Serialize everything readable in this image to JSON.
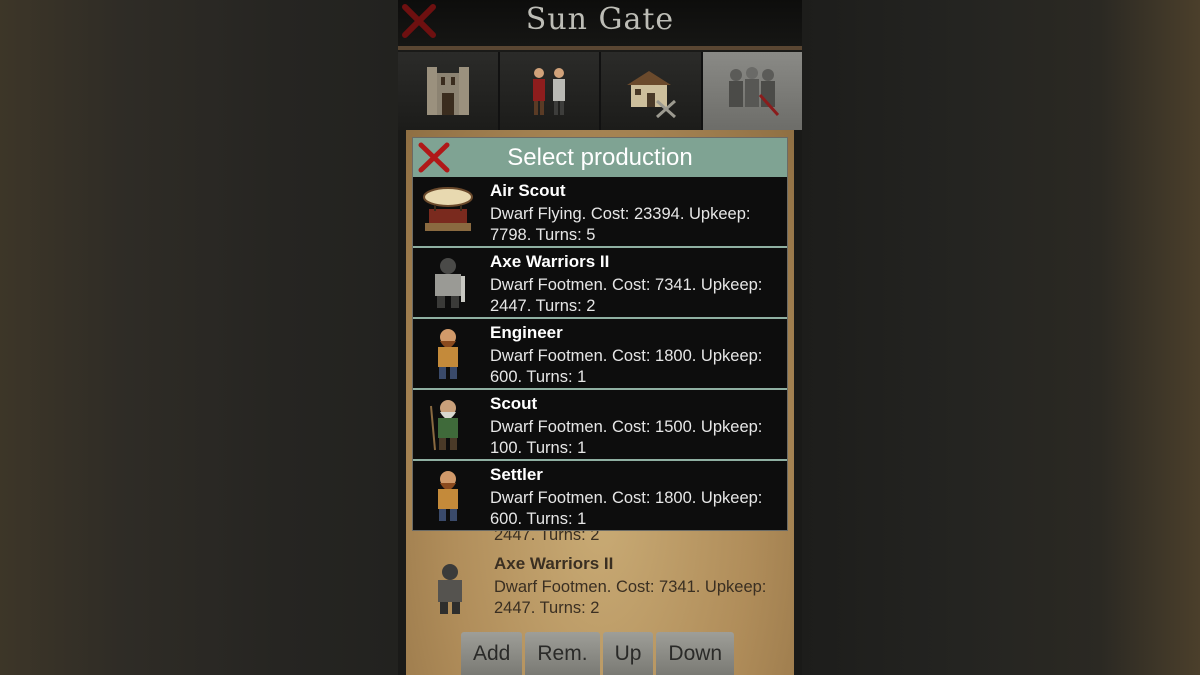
{
  "window": {
    "title": "Sun Gate"
  },
  "tabs": [
    {
      "name": "castle-icon"
    },
    {
      "name": "people-icon"
    },
    {
      "name": "buildings-icon"
    },
    {
      "name": "army-icon"
    }
  ],
  "dialog": {
    "title": "Select production",
    "items": [
      {
        "name": "Air Scout",
        "desc": "Dwarf Flying. Cost: 23394. Upkeep: 7798. Turns: 5",
        "icon": "airship-icon"
      },
      {
        "name": "Axe Warriors II",
        "desc": "Dwarf Footmen. Cost: 7341. Upkeep: 2447. Turns: 2",
        "icon": "armored-dwarf-icon"
      },
      {
        "name": "Engineer",
        "desc": "Dwarf Footmen. Cost: 1800. Upkeep: 600. Turns: 1",
        "icon": "engineer-dwarf-icon"
      },
      {
        "name": "Scout",
        "desc": "Dwarf Footmen. Cost: 1500. Upkeep: 100. Turns: 1",
        "icon": "scout-dwarf-icon"
      },
      {
        "name": "Settler",
        "desc": "Dwarf Footmen. Cost: 1800. Upkeep: 600. Turns: 1",
        "icon": "settler-dwarf-icon"
      }
    ]
  },
  "queue": {
    "partial_line": "2447. Turns: 2",
    "item": {
      "name": "Axe Warriors II",
      "line1": "Dwarf Footmen. Cost: 7341. Upkeep:",
      "line2": "2447. Turns: 2"
    }
  },
  "buttons": {
    "add": "Add",
    "remove": "Rem.",
    "up": "Up",
    "down": "Down"
  },
  "colors": {
    "dialog_header": "#7fa393",
    "close_red": "#b01818",
    "parchment": "#b08d5a"
  }
}
